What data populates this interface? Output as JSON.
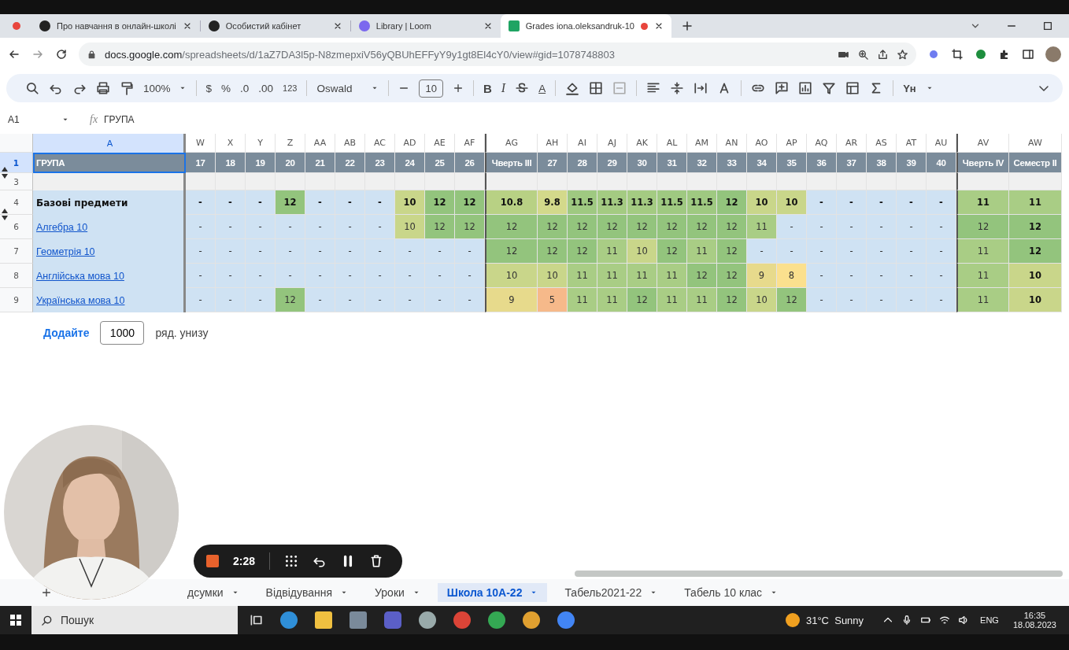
{
  "browser": {
    "tabs": [
      {
        "title": "Про навчання в онлайн-школі",
        "selected": false,
        "recording": false
      },
      {
        "title": "Особистий кабінет",
        "selected": false,
        "recording": false
      },
      {
        "title": "Library | Loom",
        "selected": false,
        "recording": false
      },
      {
        "title": "Grades iona.oleksandruk-10",
        "selected": true,
        "recording": true
      }
    ],
    "address": {
      "host": "docs.google.com",
      "path": "/spreadsheets/d/1aZ7DA3l5p-N8zmepxiV56yQBUhEFFyY9y1gt8El4cY0/view#gid=1078748803"
    }
  },
  "toolbar": {
    "zoom": "100%",
    "currency": "$",
    "percent": "%",
    "decimal_decrease": ".0",
    "decimal_increase": ".00",
    "number_format": "123",
    "font": "Oswald",
    "font_size": "10",
    "bold": "B",
    "italic": "I",
    "text_color": "A",
    "input_tools": "Yн"
  },
  "formula_bar": {
    "cell": "A1",
    "fx_label": "fx",
    "content": "ГРУПА"
  },
  "sheet": {
    "label_column": "A",
    "columns": [
      {
        "letter": "W",
        "header": "17",
        "kind": "week",
        "bold": false
      },
      {
        "letter": "X",
        "header": "18",
        "kind": "week",
        "bold": false
      },
      {
        "letter": "Y",
        "header": "19",
        "kind": "week",
        "bold": false
      },
      {
        "letter": "Z",
        "header": "20",
        "kind": "week",
        "bold": false
      },
      {
        "letter": "AA",
        "header": "21",
        "kind": "week",
        "bold": false
      },
      {
        "letter": "AB",
        "header": "22",
        "kind": "week",
        "bold": false
      },
      {
        "letter": "AC",
        "header": "23",
        "kind": "week",
        "bold": false
      },
      {
        "letter": "AD",
        "header": "24",
        "kind": "week",
        "bold": false
      },
      {
        "letter": "AE",
        "header": "25",
        "kind": "week",
        "bold": false
      },
      {
        "letter": "AF",
        "header": "26",
        "kind": "week",
        "bold": false
      },
      {
        "letter": "AG",
        "header": "Чверть III",
        "kind": "quarter",
        "bold": false
      },
      {
        "letter": "AH",
        "header": "27",
        "kind": "week",
        "bold": false
      },
      {
        "letter": "AI",
        "header": "28",
        "kind": "week",
        "bold": false
      },
      {
        "letter": "AJ",
        "header": "29",
        "kind": "week",
        "bold": false
      },
      {
        "letter": "AK",
        "header": "30",
        "kind": "week",
        "bold": false
      },
      {
        "letter": "AL",
        "header": "31",
        "kind": "week",
        "bold": false
      },
      {
        "letter": "AM",
        "header": "32",
        "kind": "week",
        "bold": false
      },
      {
        "letter": "AN",
        "header": "33",
        "kind": "week",
        "bold": false
      },
      {
        "letter": "AO",
        "header": "34",
        "kind": "week",
        "bold": false
      },
      {
        "letter": "AP",
        "header": "35",
        "kind": "week",
        "bold": false
      },
      {
        "letter": "AQ",
        "header": "36",
        "kind": "week",
        "bold": false
      },
      {
        "letter": "AR",
        "header": "37",
        "kind": "week",
        "bold": false
      },
      {
        "letter": "AS",
        "header": "38",
        "kind": "week",
        "bold": false
      },
      {
        "letter": "AT",
        "header": "39",
        "kind": "week",
        "bold": false
      },
      {
        "letter": "AU",
        "header": "40",
        "kind": "week",
        "bold": false
      },
      {
        "letter": "AV",
        "header": "Чверть IV",
        "kind": "quarter",
        "bold": false
      },
      {
        "letter": "AW",
        "header": "Семестр II",
        "kind": "semester",
        "bold": true
      }
    ],
    "header_row": {
      "number": "1",
      "label": "ГРУПА",
      "selected": true,
      "collapse_toggle": true,
      "expand_toggle": false
    },
    "rows": [
      {
        "number": "3",
        "kind": "spacer",
        "collapse_toggle": false,
        "expand_toggle": true
      },
      {
        "number": "4",
        "label": "Базові предмети",
        "kind": "group",
        "collapse_toggle": true,
        "expand_toggle": false,
        "cells": [
          {
            "text": "-",
            "color": "#cfe2f3"
          },
          {
            "text": "-",
            "color": "#cfe2f3"
          },
          {
            "text": "-",
            "color": "#cfe2f3"
          },
          {
            "text": "12",
            "color": "#93c47d"
          },
          {
            "text": "-",
            "color": "#cfe2f3"
          },
          {
            "text": "-",
            "color": "#cfe2f3"
          },
          {
            "text": "-",
            "color": "#cfe2f3"
          },
          {
            "text": "10",
            "color": "#c9d68a"
          },
          {
            "text": "12",
            "color": "#93c47d"
          },
          {
            "text": "12",
            "color": "#93c47d"
          },
          {
            "text": "10.8",
            "color": "#b8d184"
          },
          {
            "text": "9.8",
            "color": "#d3d98b"
          },
          {
            "text": "11.5",
            "color": "#9fc981"
          },
          {
            "text": "11.3",
            "color": "#a4cb82"
          },
          {
            "text": "11.3",
            "color": "#a4cb82"
          },
          {
            "text": "11.5",
            "color": "#9fc981"
          },
          {
            "text": "11.5",
            "color": "#9fc981"
          },
          {
            "text": "12",
            "color": "#93c47d"
          },
          {
            "text": "10",
            "color": "#c9d68a"
          },
          {
            "text": "10",
            "color": "#c9d68a"
          },
          {
            "text": "-",
            "color": "#cfe2f3"
          },
          {
            "text": "-",
            "color": "#cfe2f3"
          },
          {
            "text": "-",
            "color": "#cfe2f3"
          },
          {
            "text": "-",
            "color": "#cfe2f3"
          },
          {
            "text": "-",
            "color": "#cfe2f3"
          },
          {
            "text": "11",
            "color": "#a9cd85"
          },
          {
            "text": "11",
            "color": "#a9cd85"
          }
        ]
      },
      {
        "number": "6",
        "label": "Алгебра 10",
        "kind": "link",
        "collapse_toggle": false,
        "expand_toggle": true,
        "cells": [
          {
            "text": "-",
            "color": "#cfe2f3"
          },
          {
            "text": "-",
            "color": "#cfe2f3"
          },
          {
            "text": "-",
            "color": "#cfe2f3"
          },
          {
            "text": "-",
            "color": "#cfe2f3"
          },
          {
            "text": "-",
            "color": "#cfe2f3"
          },
          {
            "text": "-",
            "color": "#cfe2f3"
          },
          {
            "text": "-",
            "color": "#cfe2f3"
          },
          {
            "text": "10",
            "color": "#c9d68a"
          },
          {
            "text": "12",
            "color": "#93c47d"
          },
          {
            "text": "12",
            "color": "#93c47d"
          },
          {
            "text": "12",
            "color": "#93c47d"
          },
          {
            "text": "12",
            "color": "#93c47d"
          },
          {
            "text": "12",
            "color": "#93c47d"
          },
          {
            "text": "12",
            "color": "#93c47d"
          },
          {
            "text": "12",
            "color": "#93c47d"
          },
          {
            "text": "12",
            "color": "#93c47d"
          },
          {
            "text": "12",
            "color": "#93c47d"
          },
          {
            "text": "12",
            "color": "#93c47d"
          },
          {
            "text": "11",
            "color": "#a9cd85"
          },
          {
            "text": "-",
            "color": "#cfe2f3"
          },
          {
            "text": "-",
            "color": "#cfe2f3"
          },
          {
            "text": "-",
            "color": "#cfe2f3"
          },
          {
            "text": "-",
            "color": "#cfe2f3"
          },
          {
            "text": "-",
            "color": "#cfe2f3"
          },
          {
            "text": "-",
            "color": "#cfe2f3"
          },
          {
            "text": "12",
            "color": "#93c47d"
          },
          {
            "text": "12",
            "color": "#93c47d"
          }
        ]
      },
      {
        "number": "7",
        "label": "Геометрія 10",
        "kind": "link",
        "collapse_toggle": false,
        "expand_toggle": false,
        "cells": [
          {
            "text": "-",
            "color": "#cfe2f3"
          },
          {
            "text": "-",
            "color": "#cfe2f3"
          },
          {
            "text": "-",
            "color": "#cfe2f3"
          },
          {
            "text": "-",
            "color": "#cfe2f3"
          },
          {
            "text": "-",
            "color": "#cfe2f3"
          },
          {
            "text": "-",
            "color": "#cfe2f3"
          },
          {
            "text": "-",
            "color": "#cfe2f3"
          },
          {
            "text": "-",
            "color": "#cfe2f3"
          },
          {
            "text": "-",
            "color": "#cfe2f3"
          },
          {
            "text": "-",
            "color": "#cfe2f3"
          },
          {
            "text": "12",
            "color": "#93c47d"
          },
          {
            "text": "12",
            "color": "#93c47d"
          },
          {
            "text": "12",
            "color": "#93c47d"
          },
          {
            "text": "11",
            "color": "#a9cd85"
          },
          {
            "text": "10",
            "color": "#c9d68a"
          },
          {
            "text": "12",
            "color": "#93c47d"
          },
          {
            "text": "11",
            "color": "#a9cd85"
          },
          {
            "text": "12",
            "color": "#93c47d"
          },
          {
            "text": "-",
            "color": "#cfe2f3"
          },
          {
            "text": "-",
            "color": "#cfe2f3"
          },
          {
            "text": "-",
            "color": "#cfe2f3"
          },
          {
            "text": "-",
            "color": "#cfe2f3"
          },
          {
            "text": "-",
            "color": "#cfe2f3"
          },
          {
            "text": "-",
            "color": "#cfe2f3"
          },
          {
            "text": "-",
            "color": "#cfe2f3"
          },
          {
            "text": "11",
            "color": "#a9cd85"
          },
          {
            "text": "12",
            "color": "#93c47d"
          }
        ]
      },
      {
        "number": "8",
        "label": "Англійська мова 10",
        "kind": "link",
        "collapse_toggle": false,
        "expand_toggle": false,
        "cells": [
          {
            "text": "-",
            "color": "#cfe2f3"
          },
          {
            "text": "-",
            "color": "#cfe2f3"
          },
          {
            "text": "-",
            "color": "#cfe2f3"
          },
          {
            "text": "-",
            "color": "#cfe2f3"
          },
          {
            "text": "-",
            "color": "#cfe2f3"
          },
          {
            "text": "-",
            "color": "#cfe2f3"
          },
          {
            "text": "-",
            "color": "#cfe2f3"
          },
          {
            "text": "-",
            "color": "#cfe2f3"
          },
          {
            "text": "-",
            "color": "#cfe2f3"
          },
          {
            "text": "-",
            "color": "#cfe2f3"
          },
          {
            "text": "10",
            "color": "#c9d68a"
          },
          {
            "text": "10",
            "color": "#c9d68a"
          },
          {
            "text": "11",
            "color": "#a9cd85"
          },
          {
            "text": "11",
            "color": "#a9cd85"
          },
          {
            "text": "11",
            "color": "#a9cd85"
          },
          {
            "text": "11",
            "color": "#a9cd85"
          },
          {
            "text": "12",
            "color": "#93c47d"
          },
          {
            "text": "12",
            "color": "#93c47d"
          },
          {
            "text": "9",
            "color": "#e7da8c"
          },
          {
            "text": "8",
            "color": "#fbe08e"
          },
          {
            "text": "-",
            "color": "#cfe2f3"
          },
          {
            "text": "-",
            "color": "#cfe2f3"
          },
          {
            "text": "-",
            "color": "#cfe2f3"
          },
          {
            "text": "-",
            "color": "#cfe2f3"
          },
          {
            "text": "-",
            "color": "#cfe2f3"
          },
          {
            "text": "11",
            "color": "#a9cd85"
          },
          {
            "text": "10",
            "color": "#c9d68a"
          }
        ]
      },
      {
        "number": "9",
        "label": "Українська мова 10",
        "kind": "link",
        "collapse_toggle": false,
        "expand_toggle": false,
        "cells": [
          {
            "text": "-",
            "color": "#cfe2f3"
          },
          {
            "text": "-",
            "color": "#cfe2f3"
          },
          {
            "text": "-",
            "color": "#cfe2f3"
          },
          {
            "text": "12",
            "color": "#93c47d"
          },
          {
            "text": "-",
            "color": "#cfe2f3"
          },
          {
            "text": "-",
            "color": "#cfe2f3"
          },
          {
            "text": "-",
            "color": "#cfe2f3"
          },
          {
            "text": "-",
            "color": "#cfe2f3"
          },
          {
            "text": "-",
            "color": "#cfe2f3"
          },
          {
            "text": "-",
            "color": "#cfe2f3"
          },
          {
            "text": "9",
            "color": "#e7da8c"
          },
          {
            "text": "5",
            "color": "#f6b98a"
          },
          {
            "text": "11",
            "color": "#a9cd85"
          },
          {
            "text": "11",
            "color": "#a9cd85"
          },
          {
            "text": "12",
            "color": "#93c47d"
          },
          {
            "text": "11",
            "color": "#a9cd85"
          },
          {
            "text": "11",
            "color": "#a9cd85"
          },
          {
            "text": "12",
            "color": "#93c47d"
          },
          {
            "text": "10",
            "color": "#c9d68a"
          },
          {
            "text": "12",
            "color": "#93c47d"
          },
          {
            "text": "-",
            "color": "#cfe2f3"
          },
          {
            "text": "-",
            "color": "#cfe2f3"
          },
          {
            "text": "-",
            "color": "#cfe2f3"
          },
          {
            "text": "-",
            "color": "#cfe2f3"
          },
          {
            "text": "-",
            "color": "#cfe2f3"
          },
          {
            "text": "11",
            "color": "#a9cd85"
          },
          {
            "text": "10",
            "color": "#c9d68a"
          }
        ]
      }
    ]
  },
  "add_rows": {
    "button": "Додайте",
    "count": "1000",
    "suffix": "ряд. унизу"
  },
  "recorder": {
    "time": "2:28"
  },
  "sheet_tabs": [
    {
      "label": "дсумки",
      "selected": false
    },
    {
      "label": "Відвідування",
      "selected": false
    },
    {
      "label": "Уроки",
      "selected": false
    },
    {
      "label": "Школа 10А-22",
      "selected": true
    },
    {
      "label": "Табель2021-22",
      "selected": false
    },
    {
      "label": "Табель 10 клас",
      "selected": false
    }
  ],
  "taskbar": {
    "search": "Пошук",
    "weather": "31°C  Sunny",
    "language": "ENG",
    "time": "16:35",
    "date": "18.08.2023"
  }
}
